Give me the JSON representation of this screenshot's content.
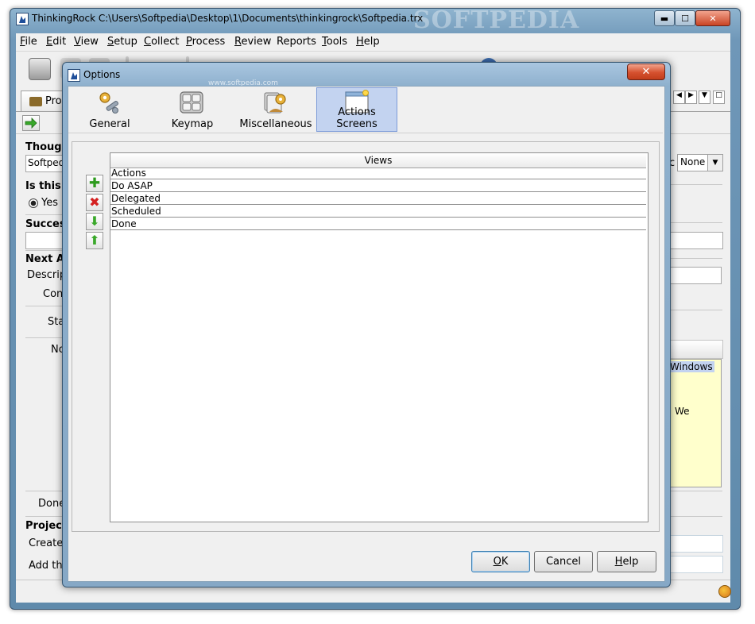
{
  "main_window": {
    "title": "ThinkingRock C:\\Users\\Softpedia\\Desktop\\1\\Documents\\thinkingrock\\Softpedia.trx",
    "minimize_glyph": "▬",
    "maximize_glyph": "☐",
    "close_glyph": "✕"
  },
  "menu": [
    {
      "key": "F",
      "rest": "ile"
    },
    {
      "key": "E",
      "rest": "dit"
    },
    {
      "key": "V",
      "rest": "iew"
    },
    {
      "key": "S",
      "rest": "etup"
    },
    {
      "key": "C",
      "rest": "ollect"
    },
    {
      "key": "P",
      "rest": "rocess"
    },
    {
      "key": "R",
      "rest": "eview"
    },
    {
      "key": "",
      "rest": "Reports"
    },
    {
      "key": "T",
      "rest": "ools"
    },
    {
      "key": "H",
      "rest": "elp"
    }
  ],
  "watermark": {
    "text": "SOFTPEDIA",
    "sub": "www.softpedia.com"
  },
  "background": {
    "tab_label": "Proc",
    "thought_label": "Though",
    "thought_value": "Softped",
    "is_this_label": "Is this A",
    "yes_label": "Yes",
    "success_label": "Succes",
    "next_action_label": "Next Ac",
    "description_label": "Descrip",
    "context_label": "Con",
    "state_label": "Sta",
    "notes_label": "No",
    "done_label": "Done",
    "project_label": "Project",
    "create_label": "Create",
    "add_label": "Add thi",
    "topic_label": "c",
    "topic_value": "None",
    "note_line1": "Windows",
    "note_line2": "We"
  },
  "dialog": {
    "title": "Options",
    "close_glyph": "✕",
    "categories": [
      {
        "label": "General",
        "icon": "wrench-gear-icon"
      },
      {
        "label": "Keymap",
        "icon": "keyboard-icon"
      },
      {
        "label": "Miscellaneous",
        "icon": "cards-gear-icon"
      },
      {
        "label": "Actions Screens",
        "icon": "window-icon",
        "selected": true
      }
    ],
    "table": {
      "header": "Views",
      "rows": [
        "Actions",
        "Do ASAP",
        "Delegated",
        "Scheduled",
        "Done"
      ]
    },
    "side_buttons": [
      {
        "name": "add",
        "icon": "plus-icon",
        "glyph": "✚"
      },
      {
        "name": "remove",
        "icon": "cross-icon",
        "glyph": "✖"
      },
      {
        "name": "move-down",
        "icon": "arrow-down-icon",
        "glyph": "⬇"
      },
      {
        "name": "move-up",
        "icon": "arrow-up-icon",
        "glyph": "⬆"
      }
    ],
    "buttons": {
      "ok_key": "O",
      "ok_rest": "K",
      "cancel": "Cancel",
      "help_key": "H",
      "help_rest": "elp"
    }
  },
  "colors": {
    "selection": "#c3d3f0",
    "note_bg": "#ffffcc",
    "plus": "#2e9b1e",
    "cross": "#d42020",
    "arrow": "#3aa82a"
  }
}
